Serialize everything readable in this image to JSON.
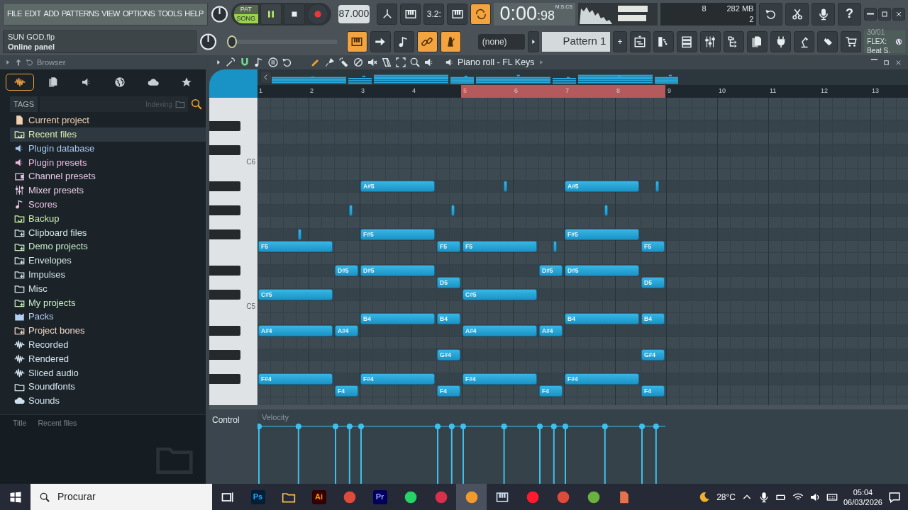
{
  "menu": [
    "FILE",
    "EDIT",
    "ADD",
    "PATTERNS",
    "VIEW",
    "OPTIONS",
    "TOOLS",
    "HELP"
  ],
  "hint_panel": {
    "title": "SUN GOD.flp",
    "text": "Online panel"
  },
  "transport": {
    "modes": [
      {
        "label": "PAT",
        "selected": false
      },
      {
        "label": "SONG",
        "selected": true
      }
    ],
    "playing": true,
    "tempo": "87.000"
  },
  "toolbar_top": [
    {
      "kind": "fork",
      "on": false
    },
    {
      "kind": "keys",
      "on": false
    },
    {
      "kind": "countdown",
      "label": "3.2:",
      "on": false
    },
    {
      "kind": "keys",
      "on": false
    },
    {
      "kind": "loop",
      "on": true
    }
  ],
  "time": {
    "value": "0:00",
    "fraction": ":98",
    "format": "M:S:CS"
  },
  "cpu_panel": {
    "cpu": "8",
    "memory": "282 MB",
    "polyphony": "2"
  },
  "top_right_buttons": [
    {
      "kind": "undo"
    },
    {
      "kind": "cut"
    },
    {
      "kind": "mic"
    },
    {
      "kind": "help",
      "label": "?"
    }
  ],
  "master_pitch": {
    "level": 0
  },
  "toolbar_bottom": [
    {
      "kind": "keys",
      "on": true
    },
    {
      "kind": "arrow",
      "on": false
    },
    {
      "kind": "note",
      "on": false
    },
    {
      "kind": "link",
      "on": true
    },
    {
      "kind": "metronome",
      "on": true
    }
  ],
  "pattern_picker": {
    "arrangement": "(none)",
    "pattern": "Pattern 1",
    "add": "+"
  },
  "window_buttons": [
    {
      "kind": "playlist"
    },
    {
      "kind": "steps"
    },
    {
      "kind": "channels"
    },
    {
      "kind": "sliders"
    },
    {
      "kind": "tree"
    },
    {
      "kind": "files"
    },
    {
      "kind": "plug"
    },
    {
      "kind": "lamp"
    },
    {
      "kind": "hand"
    },
    {
      "kind": "cart"
    }
  ],
  "news": {
    "date": "30/01",
    "headline": "FLEX: Beat S."
  },
  "browser": {
    "title": "Browser",
    "tabs": [
      {
        "kind": "wave",
        "selected": true
      },
      {
        "kind": "files",
        "selected": false
      },
      {
        "kind": "speaker",
        "selected": false
      },
      {
        "kind": "globe",
        "selected": false
      },
      {
        "kind": "cloud",
        "selected": false
      },
      {
        "kind": "star",
        "selected": false
      }
    ],
    "tags_label": "TAGS",
    "status": "Indexing",
    "items": [
      {
        "label": "Current project",
        "kind": "file",
        "color": "#f2cfae",
        "selected": false
      },
      {
        "label": "Recent files",
        "kind": "folderrefresh",
        "color": "#d9f2b4",
        "selected": true
      },
      {
        "label": "Plugin database",
        "kind": "speaker",
        "color": "#a9c8f2",
        "selected": false
      },
      {
        "label": "Plugin presets",
        "kind": "speaker",
        "color": "#f0b6df",
        "selected": false
      },
      {
        "label": "Channel presets",
        "kind": "box",
        "color": "#e6c8e8",
        "selected": false
      },
      {
        "label": "Mixer presets",
        "kind": "sliders",
        "color": "#e8cbe6",
        "selected": false
      },
      {
        "label": "Scores",
        "kind": "note",
        "color": "#efc6e6",
        "selected": false
      },
      {
        "label": "Backup",
        "kind": "folderrefresh",
        "color": "#cdf0aa",
        "selected": false
      },
      {
        "label": "Clipboard files",
        "kind": "folderplus",
        "color": "#d3e6e6",
        "selected": false
      },
      {
        "label": "Demo projects",
        "kind": "folderplus",
        "color": "#c9edc9",
        "selected": false
      },
      {
        "label": "Envelopes",
        "kind": "folderplus",
        "color": "#d2e8e0",
        "selected": false
      },
      {
        "label": "Impulses",
        "kind": "folderplus",
        "color": "#d2e0ea",
        "selected": false
      },
      {
        "label": "Misc",
        "kind": "folder",
        "color": "#d8e8e8",
        "selected": false
      },
      {
        "label": "My projects",
        "kind": "folderplus",
        "color": "#c8efc8",
        "selected": false
      },
      {
        "label": "Packs",
        "kind": "packs",
        "color": "#b2d0f6",
        "selected": false
      },
      {
        "label": "Project bones",
        "kind": "folderplus",
        "color": "#f0d8c6",
        "selected": false
      },
      {
        "label": "Recorded",
        "kind": "wave",
        "color": "#d2e2f0",
        "selected": false
      },
      {
        "label": "Rendered",
        "kind": "wave",
        "color": "#d6e2ee",
        "selected": false
      },
      {
        "label": "Sliced audio",
        "kind": "wave",
        "color": "#d4e4f0",
        "selected": false
      },
      {
        "label": "Soundfonts",
        "kind": "folder",
        "color": "#d8e8f0",
        "selected": false
      },
      {
        "label": "Sounds",
        "kind": "cloud",
        "color": "#d0e0ee",
        "selected": false
      }
    ],
    "footer": {
      "label": "Title",
      "value": "Recent files"
    }
  },
  "piano_roll": {
    "title": "Piano roll - FL Keys",
    "tools": [
      {
        "kind": "wrench",
        "on": false
      },
      {
        "kind": "magnet",
        "on": true
      },
      {
        "kind": "note",
        "on": false
      },
      {
        "kind": "menu",
        "on": false
      },
      {
        "kind": "undo",
        "on": false
      },
      {
        "kind": "pencil",
        "on": true
      },
      {
        "kind": "brush",
        "on": false
      },
      {
        "kind": "paint",
        "on": false
      },
      {
        "kind": "ban",
        "on": false
      },
      {
        "kind": "mute",
        "on": false
      },
      {
        "kind": "slice",
        "on": false
      },
      {
        "kind": "select",
        "on": false
      },
      {
        "kind": "zoom",
        "on": false
      },
      {
        "kind": "speaker",
        "on": false
      }
    ],
    "ruler": [
      {
        "label": "1",
        "in_loop": false
      },
      {
        "label": "2",
        "in_loop": false
      },
      {
        "label": "3",
        "in_loop": false
      },
      {
        "label": "4",
        "in_loop": false
      },
      {
        "label": "5",
        "in_loop": true
      },
      {
        "label": "6",
        "in_loop": true
      },
      {
        "label": "7",
        "in_loop": true
      },
      {
        "label": "8",
        "in_loop": true
      },
      {
        "label": "9",
        "in_loop": false
      },
      {
        "label": "10",
        "in_loop": false
      },
      {
        "label": "11",
        "in_loop": false
      },
      {
        "label": "12",
        "in_loop": false
      },
      {
        "label": "13",
        "in_loop": false
      }
    ],
    "keyboard_labels": [
      "C6",
      "C5"
    ],
    "notes": [
      {
        "label": "F5",
        "kind": "note"
      },
      {
        "label": "C#5",
        "kind": "note"
      },
      {
        "label": "A#4",
        "kind": "note"
      },
      {
        "label": "F#4",
        "kind": "note"
      },
      {
        "kind": "tiny"
      },
      {
        "label": "D#5",
        "kind": "note"
      },
      {
        "label": "A#4",
        "kind": "note"
      },
      {
        "label": "F4",
        "kind": "note"
      },
      {
        "kind": "tiny"
      },
      {
        "label": "A#5",
        "kind": "note"
      },
      {
        "label": "F#5",
        "kind": "note"
      },
      {
        "label": "D#5",
        "kind": "note"
      },
      {
        "label": "B4",
        "kind": "note"
      },
      {
        "label": "F#4",
        "kind": "note"
      },
      {
        "label": "F5",
        "kind": "note"
      },
      {
        "label": "D5",
        "kind": "note"
      },
      {
        "label": "B4",
        "kind": "note"
      },
      {
        "label": "G#4",
        "kind": "note"
      },
      {
        "label": "F4",
        "kind": "note"
      },
      {
        "kind": "tiny"
      },
      {
        "label": "F5",
        "kind": "note"
      },
      {
        "label": "C#5",
        "kind": "note"
      },
      {
        "label": "A#4",
        "kind": "note"
      },
      {
        "label": "F#4",
        "kind": "note"
      },
      {
        "kind": "tiny"
      },
      {
        "label": "D#5",
        "kind": "note"
      },
      {
        "label": "A#4",
        "kind": "note"
      },
      {
        "label": "F4",
        "kind": "note"
      },
      {
        "kind": "tiny"
      },
      {
        "label": "A#5",
        "kind": "note"
      },
      {
        "label": "F#5",
        "kind": "note"
      },
      {
        "label": "D#5",
        "kind": "note"
      },
      {
        "label": "B4",
        "kind": "note"
      },
      {
        "label": "F#4",
        "kind": "note"
      },
      {
        "kind": "tiny"
      },
      {
        "label": "F5",
        "kind": "note"
      },
      {
        "label": "D5",
        "kind": "note"
      },
      {
        "label": "B4",
        "kind": "note"
      },
      {
        "label": "G#4",
        "kind": "note"
      },
      {
        "label": "F4",
        "kind": "note"
      },
      {
        "kind": "tiny"
      }
    ],
    "control": {
      "label": "Control",
      "parameter": "Velocity"
    }
  },
  "taskbar": {
    "search": "Procurar",
    "apps": [
      {
        "kind": "taskview",
        "active": false
      },
      {
        "kind": "ps",
        "label": "Ps",
        "active": false
      },
      {
        "kind": "folder",
        "active": false
      },
      {
        "kind": "ai",
        "label": "Ai",
        "active": false
      },
      {
        "kind": "chrome",
        "active": false
      },
      {
        "kind": "pr",
        "label": "Pr",
        "active": false
      },
      {
        "kind": "whatsapp",
        "active": false
      },
      {
        "kind": "redapp",
        "active": false
      },
      {
        "kind": "fl",
        "active": true
      },
      {
        "kind": "monitor",
        "active": false
      },
      {
        "kind": "opera",
        "active": false
      },
      {
        "kind": "chrome",
        "active": false
      },
      {
        "kind": "torrent",
        "active": false
      },
      {
        "kind": "slides",
        "active": false
      }
    ],
    "weather": "28°C",
    "time": "05:04",
    "date": "06/03/2026"
  }
}
